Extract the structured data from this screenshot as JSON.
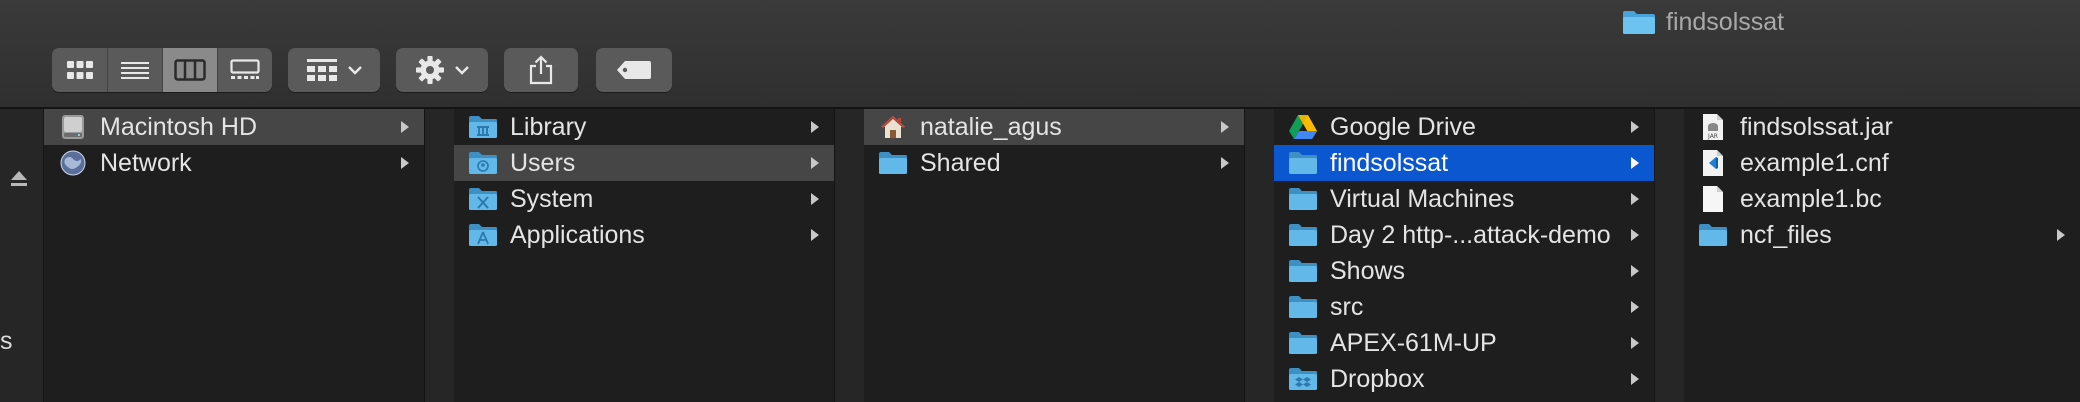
{
  "window": {
    "title": "findsolssat"
  },
  "toolbar": {
    "view_buttons": [
      "icon-view-icon",
      "list-view-icon",
      "column-view-icon",
      "gallery-view-icon"
    ],
    "active_view": 2,
    "group_button": "group-icon",
    "action_button": "gear-icon",
    "share_button": "share-icon",
    "tag_button": "tag-icon"
  },
  "columns": [
    {
      "items": [
        {
          "label": "Macintosh HD",
          "icon": "hard-drive-icon",
          "state": "gray",
          "arrow": true
        },
        {
          "label": "Network",
          "icon": "globe-icon",
          "state": "",
          "arrow": true
        }
      ]
    },
    {
      "items": [
        {
          "label": "Library",
          "icon": "library-folder-icon",
          "state": "",
          "arrow": true
        },
        {
          "label": "Users",
          "icon": "users-folder-icon",
          "state": "gray",
          "arrow": true
        },
        {
          "label": "System",
          "icon": "system-folder-icon",
          "state": "",
          "arrow": true
        },
        {
          "label": "Applications",
          "icon": "applications-folder-icon",
          "state": "",
          "arrow": true
        }
      ]
    },
    {
      "items": [
        {
          "label": "natalie_agus",
          "icon": "home-icon",
          "state": "gray",
          "arrow": true
        },
        {
          "label": "Shared",
          "icon": "folder-icon",
          "state": "",
          "arrow": true
        }
      ]
    },
    {
      "items": [
        {
          "label": "Google Drive",
          "icon": "google-drive-icon",
          "state": "",
          "arrow": true
        },
        {
          "label": "findsolssat",
          "icon": "folder-icon",
          "state": "blue",
          "arrow": true
        },
        {
          "label": "Virtual Machines",
          "icon": "folder-icon",
          "state": "",
          "arrow": true
        },
        {
          "label": "Day 2 http-...attack-demo",
          "icon": "folder-icon",
          "state": "",
          "arrow": true
        },
        {
          "label": "Shows",
          "icon": "folder-icon",
          "state": "",
          "arrow": true
        },
        {
          "label": "src",
          "icon": "folder-icon",
          "state": "",
          "arrow": true
        },
        {
          "label": "APEX-61M-UP",
          "icon": "folder-icon",
          "state": "",
          "arrow": true
        },
        {
          "label": "Dropbox",
          "icon": "dropbox-folder-icon",
          "state": "",
          "arrow": true
        }
      ]
    },
    {
      "items": [
        {
          "label": "findsolssat.jar",
          "icon": "jar-file-icon",
          "state": "",
          "arrow": false
        },
        {
          "label": "example1.cnf",
          "icon": "vscode-file-icon",
          "state": "",
          "arrow": false
        },
        {
          "label": "example1.bc",
          "icon": "document-icon",
          "state": "",
          "arrow": false
        },
        {
          "label": "ncf_files",
          "icon": "folder-icon",
          "state": "",
          "arrow": true
        }
      ]
    }
  ],
  "sidebar": {
    "partial_label": "s"
  },
  "colors": {
    "selection_blue": "#0b57d0",
    "selection_gray": "#464646",
    "folder_blue": "#5bb6e6"
  }
}
